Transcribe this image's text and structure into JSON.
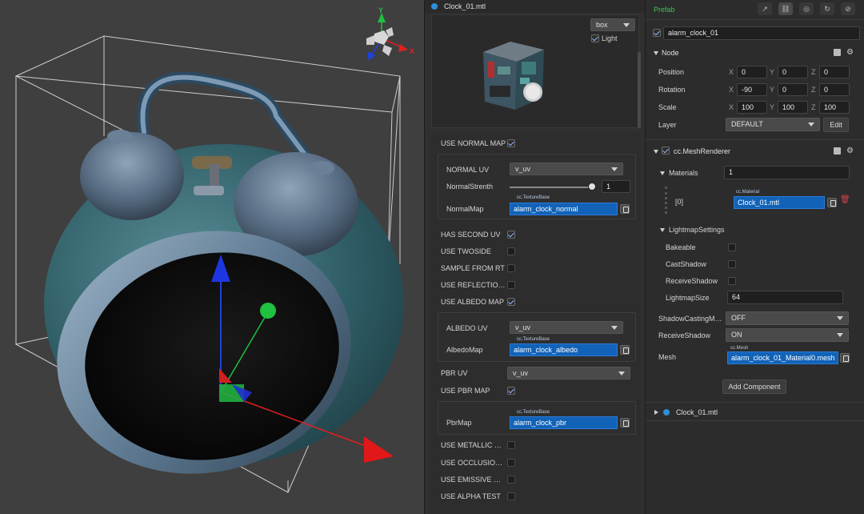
{
  "viewport": {
    "gizmo_axes": {
      "y": "Y",
      "x": "X"
    }
  },
  "material": {
    "title": "Clock_01.mtl",
    "preview_mesh": "box",
    "light_label": "Light",
    "use_normal_map": "USE NORMAL MAP",
    "normal_uv_label": "NORMAL UV",
    "normal_uv_value": "v_uv",
    "normal_strength_label": "NormalStrenth",
    "normal_strength_value": "1",
    "normal_map_label": "NormalMap",
    "normal_map_type": "cc.TextureBase",
    "normal_map_value": "alarm_clock_normal",
    "has_second_uv": "HAS SECOND UV",
    "use_twoside": "USE TWOSIDE",
    "sample_from_rt": "SAMPLE FROM RT",
    "use_reflection": "USE REFLECTIO…",
    "use_albedo_map": "USE ALBEDO MAP",
    "albedo_uv_label": "ALBEDO UV",
    "albedo_uv_value": "v_uv",
    "albedo_map_label": "AlbedoMap",
    "albedo_map_type": "cc.TextureBase",
    "albedo_map_value": "alarm_clock_albedo",
    "pbr_uv_label": "PBR UV",
    "pbr_uv_value": "v_uv",
    "use_pbr_map": "USE PBR MAP",
    "pbr_map_label": "PbrMap",
    "pbr_map_type": "cc.TextureBase",
    "pbr_map_value": "alarm_clock_pbr",
    "use_metallic": "USE METALLIC …",
    "use_occlusion": "USE OCCLUSIO…",
    "use_emissive": "USE EMISSIVE …",
    "use_alpha_test": "USE ALPHA TEST"
  },
  "inspector": {
    "header": "Prefab",
    "node_name": "alarm_clock_01",
    "node_section": "Node",
    "position_label": "Position",
    "rotation_label": "Rotation",
    "scale_label": "Scale",
    "layer_label": "Layer",
    "axis_x": "X",
    "axis_y": "Y",
    "axis_z": "Z",
    "position": {
      "x": "0",
      "y": "0",
      "z": "0"
    },
    "rotation": {
      "x": "-90",
      "y": "0",
      "z": "0"
    },
    "scale": {
      "x": "100",
      "y": "100",
      "z": "100"
    },
    "layer_value": "DEFAULT",
    "edit_button": "Edit",
    "mesh_renderer": "cc.MeshRenderer",
    "materials_label": "Materials",
    "materials_count": "1",
    "material_index": "[0]",
    "material_type": "cc.Material",
    "material_value": "Clock_01.mtl",
    "lightmap_settings": "LightmapSettings",
    "bakeable": "Bakeable",
    "cast_shadow": "CastShadow",
    "receive_shadow_lm": "ReceiveShadow",
    "lightmap_size_label": "LightmapSize",
    "lightmap_size_value": "64",
    "shadow_casting_label": "ShadowCastingM…",
    "shadow_casting_value": "OFF",
    "receive_shadow_label": "ReceiveShadow",
    "receive_shadow_value": "ON",
    "mesh_label": "Mesh",
    "mesh_type": "cc.Mesh",
    "mesh_value": "alarm_clock_01_Material0.mesh",
    "add_component": "Add Component",
    "material_asset": "Clock_01.mtl"
  },
  "colors": {
    "asset_blue": "#1263b8",
    "prefab_green": "#3fbf5a",
    "axis_red": "#e02020",
    "axis_green": "#20c040",
    "axis_blue": "#2040e0",
    "clock_teal": "#3d6f78"
  }
}
